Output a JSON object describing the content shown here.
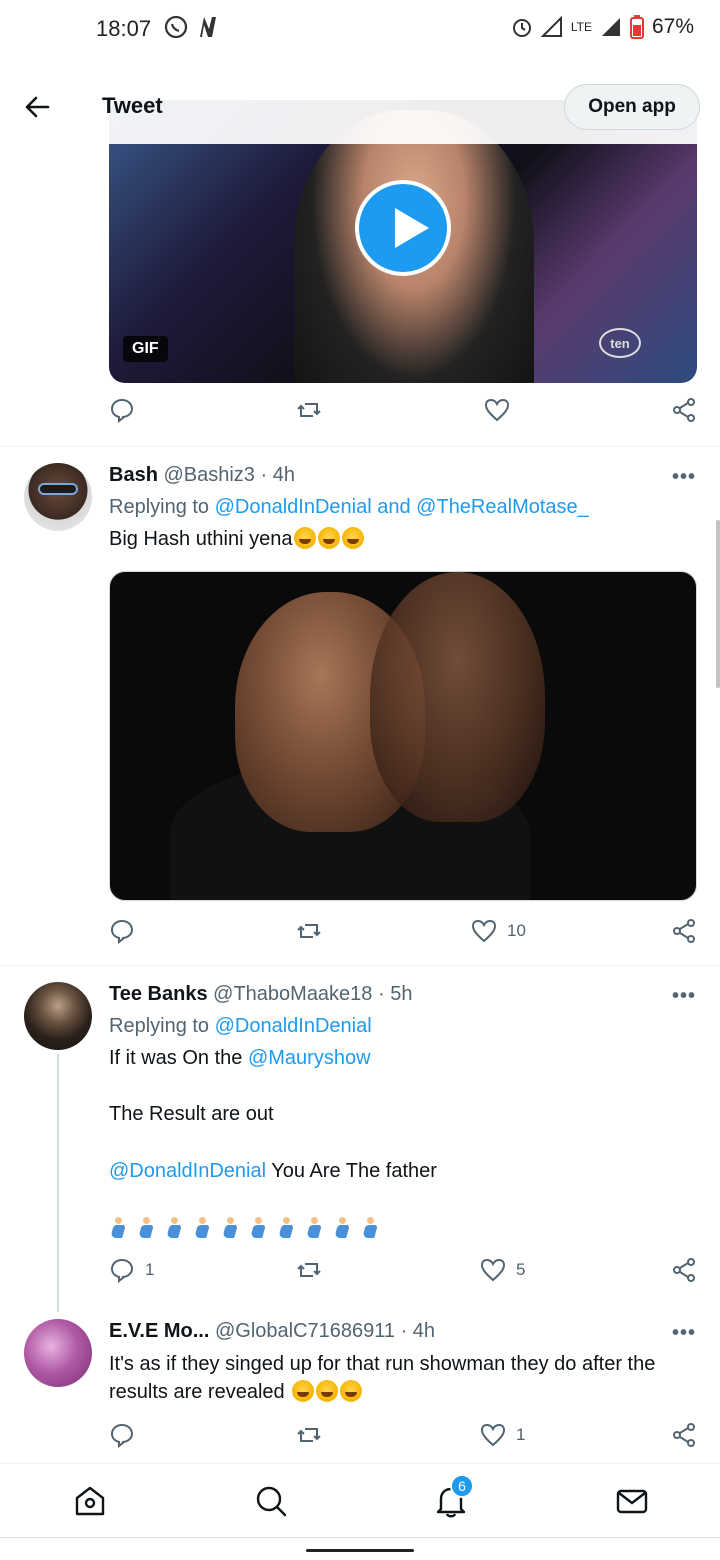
{
  "status_bar": {
    "time": "18:07",
    "network": "LTE",
    "battery": "67%"
  },
  "header": {
    "title": "Tweet",
    "open_app_label": "Open app"
  },
  "first_media": {
    "badge": "GIF",
    "logo": "ten"
  },
  "tweets": [
    {
      "name": "Bash",
      "handle": "@Bashiz3",
      "time": "· 4h",
      "replying_prefix": "Replying to",
      "replying_to": "@DonaldInDenial and @TheRealMotase_",
      "text": "Big Hash uthini yena",
      "likes": "10"
    },
    {
      "name": "Tee Banks",
      "handle": "@ThaboMaake18",
      "time": "· 5h",
      "replying_prefix": "Replying to",
      "replying_to": "@DonaldInDenial",
      "line1_prefix": "If it was On the",
      "line1_mention": "@Mauryshow",
      "line2": "The Result are out",
      "line3_mention": "@DonaldInDenial",
      "line3_text": "You Are The father",
      "replies": "1",
      "likes": "5"
    },
    {
      "name": "E.V.E Mo...",
      "handle": "@GlobalC71686911",
      "time": "· 4h",
      "text": "It's as if they singed up for that run showman they do after the results are revealed",
      "likes": "1"
    }
  ],
  "bottom_nav": {
    "notification_count": "6"
  },
  "colors": {
    "accent": "#1d9bf0",
    "secondary_text": "#536471"
  }
}
